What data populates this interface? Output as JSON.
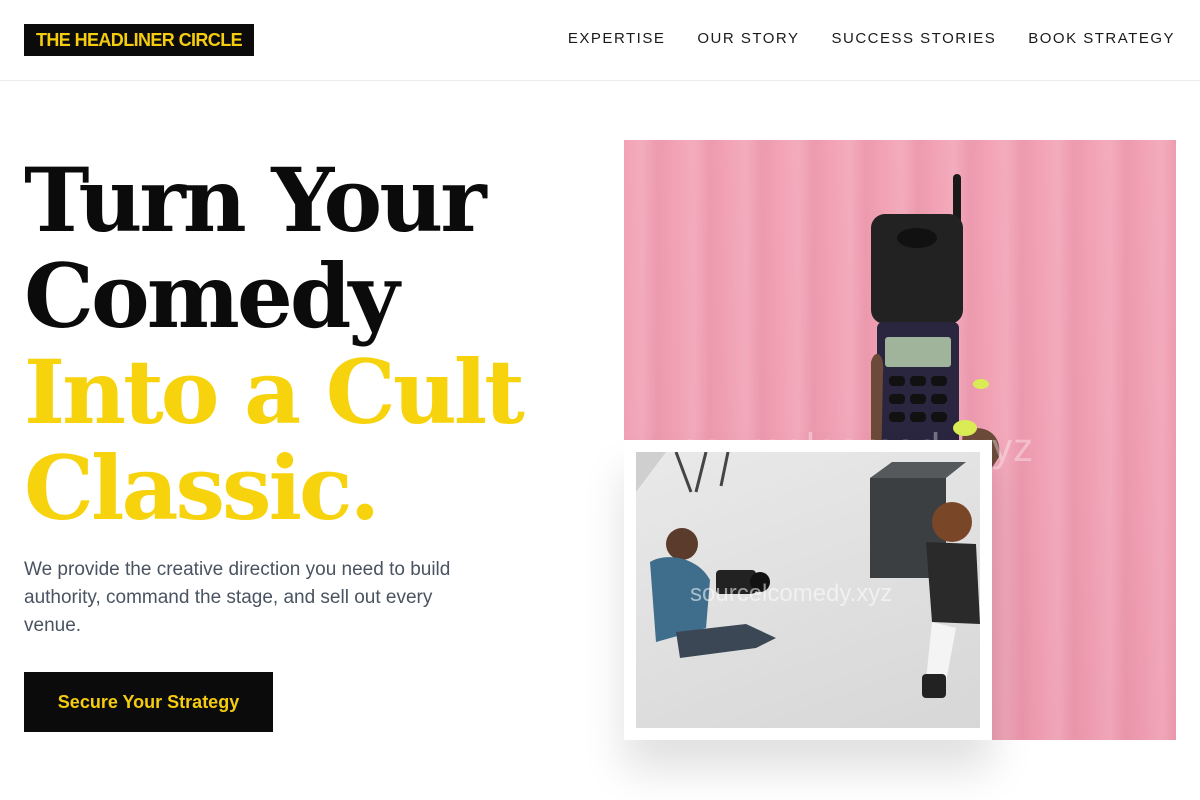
{
  "brand": {
    "logo_text": "THE HEADLINER CIRCLE",
    "colors": {
      "accent": "#f7d30e",
      "dark": "#0b0b0b",
      "body_text": "#4a5361",
      "pink": "#f2a3b5"
    }
  },
  "nav": {
    "items": [
      {
        "label": "EXPERTISE"
      },
      {
        "label": "OUR STORY"
      },
      {
        "label": "SUCCESS STORIES"
      },
      {
        "label": "BOOK STRATEGY"
      }
    ]
  },
  "hero": {
    "headline_lines": [
      "Turn Your",
      "Comedy",
      "Into a Cult",
      "Classic."
    ],
    "subcopy": "We provide the creative direction you need to build authority, command the stage, and sell out every venue.",
    "cta_label": "Secure Your Strategy",
    "main_image_watermark": "sourcelcomedy.xyz",
    "inset_image_watermark": "sourcelcomedy.xyz"
  },
  "icons": {
    "main_image": "retro-flip-phone-photo",
    "inset_image": "photographer-shoot-photo"
  }
}
